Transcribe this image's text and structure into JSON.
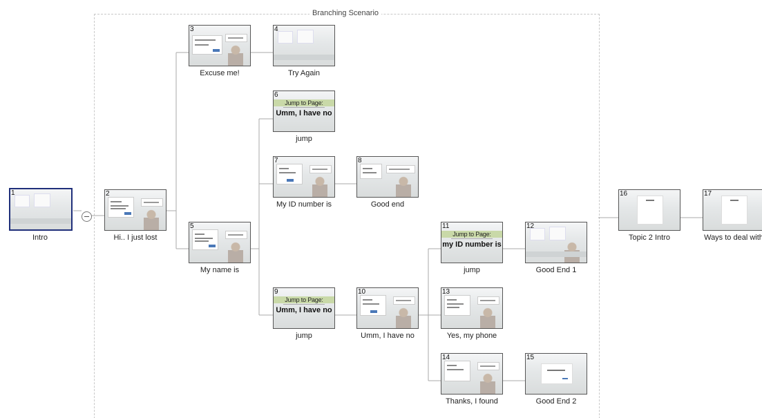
{
  "group": {
    "title": "Branching Scenario"
  },
  "nodes": {
    "n1": {
      "number": "1",
      "label": "Intro"
    },
    "n2": {
      "number": "2",
      "label": "Hi.. I just lost"
    },
    "n3": {
      "number": "3",
      "label": "Excuse me!"
    },
    "n4": {
      "number": "4",
      "label": "Try Again"
    },
    "n5": {
      "number": "5",
      "label": "My name is"
    },
    "n6": {
      "number": "6",
      "label": "jump",
      "banner": "Jump to Page:",
      "text": "Umm, I have no"
    },
    "n7": {
      "number": "7",
      "label": "My ID number is"
    },
    "n8": {
      "number": "8",
      "label": "Good end"
    },
    "n9": {
      "number": "9",
      "label": "jump",
      "banner": "Jump to Page:",
      "text": "Umm, I have no"
    },
    "n10": {
      "number": "10",
      "label": "Umm, I have no"
    },
    "n11": {
      "number": "11",
      "label": "jump",
      "banner": "Jump to Page:",
      "text": "my ID number is"
    },
    "n12": {
      "number": "12",
      "label": "Good End 1"
    },
    "n13": {
      "number": "13",
      "label": "Yes, my phone"
    },
    "n14": {
      "number": "14",
      "label": "Thanks, I found"
    },
    "n15": {
      "number": "15",
      "label": "Good End 2"
    },
    "n16": {
      "number": "16",
      "label": "Topic 2 Intro"
    },
    "n17": {
      "number": "17",
      "label": "Ways to deal with"
    }
  },
  "colors": {
    "selected_border": "#1f2f7a",
    "connector": "#aaaaaa",
    "jump_banner": "#c9d9a8"
  },
  "icons": {
    "collapse": "minus-circle-icon"
  }
}
